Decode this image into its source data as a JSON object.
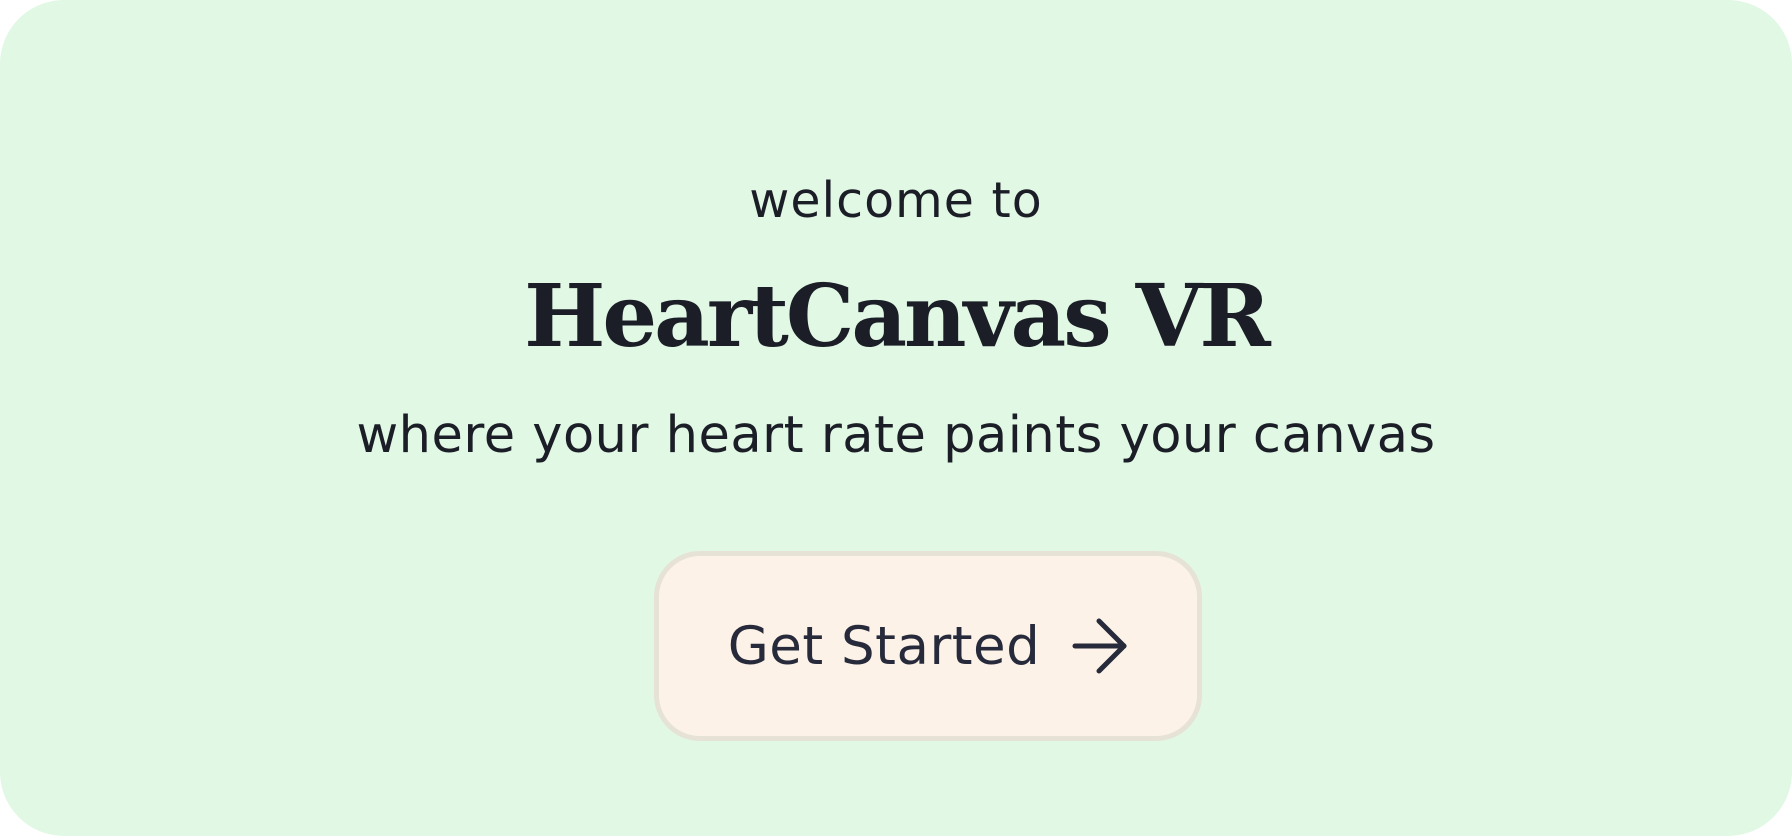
{
  "hero": {
    "welcome": "welcome to",
    "title": "HeartCanvas VR",
    "tagline": "where your heart rate paints your canvas"
  },
  "cta": {
    "label": "Get Started",
    "icon": "arrow-right-icon"
  },
  "colors": {
    "background": "#e1f8e4",
    "text": "#1b1e27",
    "button_background": "#fcf2e8",
    "button_border": "#e6e2d6"
  }
}
